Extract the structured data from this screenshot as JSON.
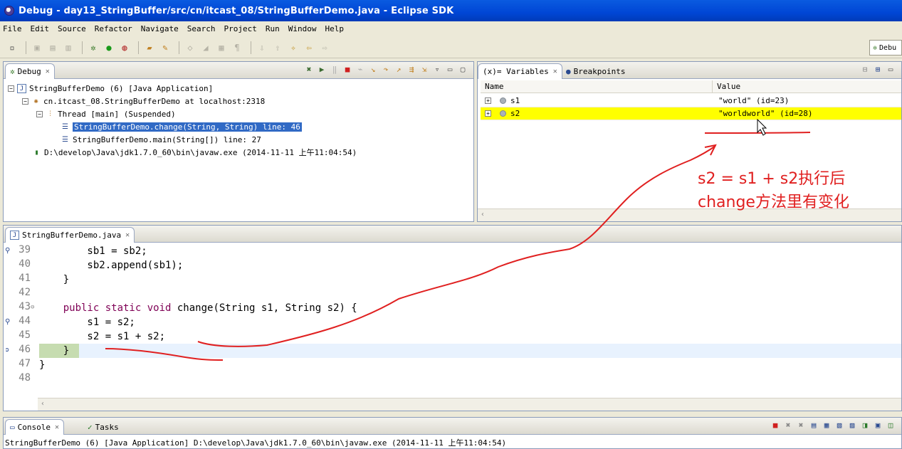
{
  "window": {
    "title": "Debug - day13_StringBuffer/src/cn/itcast_08/StringBufferDemo.java - Eclipse SDK"
  },
  "menu": [
    "File",
    "Edit",
    "Source",
    "Refactor",
    "Navigate",
    "Search",
    "Project",
    "Run",
    "Window",
    "Help"
  ],
  "perspective": {
    "label": "Debu"
  },
  "debug_view": {
    "tab": "Debug",
    "tree": [
      {
        "label": "StringBufferDemo (6) [Java Application]"
      },
      {
        "label": "cn.itcast_08.StringBufferDemo at localhost:2318"
      },
      {
        "label": "Thread [main] (Suspended)"
      },
      {
        "label": "StringBufferDemo.change(String, String) line: 46"
      },
      {
        "label": "StringBufferDemo.main(String[]) line: 27"
      },
      {
        "label": "D:\\develop\\Java\\jdk1.7.0_60\\bin\\javaw.exe (2014-11-11 上午11:04:54)"
      }
    ]
  },
  "variables_view": {
    "tab": "(x)= Variables",
    "tab2": "Breakpoints",
    "col_name": "Name",
    "col_value": "Value",
    "rows": [
      {
        "name": "s1",
        "value": "\"world\" (id=23)"
      },
      {
        "name": "s2",
        "value": "\"worldworld\" (id=28)"
      }
    ]
  },
  "editor": {
    "tab": "StringBufferDemo.java",
    "lines": [
      {
        "num": "39",
        "code": "        sb1 = sb2;"
      },
      {
        "num": "40",
        "code": "        sb2.append(sb1);"
      },
      {
        "num": "41",
        "code": "    }"
      },
      {
        "num": "42",
        "code": ""
      },
      {
        "num": "43",
        "code_kw": "    public static void",
        "code_rest": " change(String s1, String s2) {"
      },
      {
        "num": "44",
        "code": "        s1 = s2;"
      },
      {
        "num": "45",
        "code": "        s2 = s1 + s2;"
      },
      {
        "num": "46",
        "code": "    }"
      },
      {
        "num": "47",
        "code": "}"
      },
      {
        "num": "48",
        "code": ""
      }
    ]
  },
  "console": {
    "tab": "Console",
    "tab2": "Tasks",
    "text": "StringBufferDemo (6) [Java Application] D:\\develop\\Java\\jdk1.7.0_60\\bin\\javaw.exe (2014-11-11 上午11:04:54)"
  },
  "annotation": {
    "line1": "s2 = s1 + s2执行后",
    "line2": "change方法里有变化",
    "color": "#e02020"
  }
}
